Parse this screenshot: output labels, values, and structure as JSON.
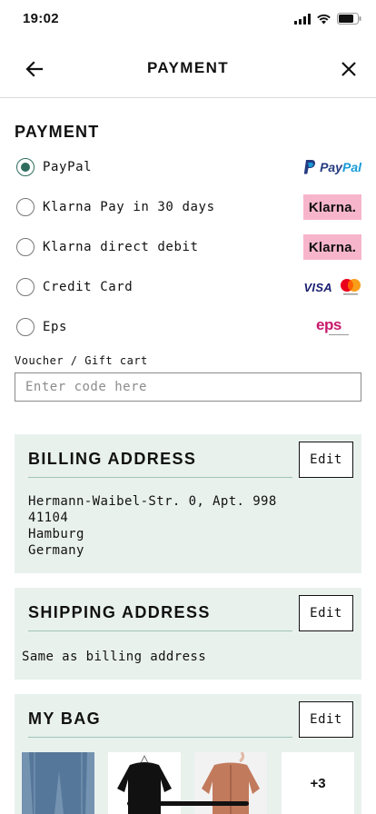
{
  "status_bar": {
    "time": "19:02"
  },
  "nav": {
    "title": "PAYMENT"
  },
  "payment": {
    "title": "PAYMENT",
    "options": [
      {
        "label": "PayPal",
        "selected": true,
        "logo": "paypal-logo"
      },
      {
        "label": "Klarna Pay in 30 days",
        "selected": false,
        "logo": "klarna-logo"
      },
      {
        "label": "Klarna direct debit",
        "selected": false,
        "logo": "klarna-logo"
      },
      {
        "label": "Credit Card",
        "selected": false,
        "logo": "visa-mastercard-logo"
      },
      {
        "label": "Eps",
        "selected": false,
        "logo": "eps-logo"
      }
    ],
    "logos": {
      "paypal": "PayPal",
      "klarna": "Klarna.",
      "visa": "VISA",
      "eps": "eps"
    }
  },
  "voucher": {
    "label": "Voucher / Gift cart",
    "placeholder": "Enter code here"
  },
  "billing": {
    "title": "BILLING ADDRESS",
    "edit_label": "Edit",
    "lines": [
      "Hermann-Waibel-Str. 0, Apt. 998",
      "41104",
      "Hamburg",
      "Germany"
    ]
  },
  "shipping": {
    "title": "SHIPPING ADDRESS",
    "edit_label": "Edit",
    "text": "Same as billing address"
  },
  "bag": {
    "title": "MY BAG",
    "edit_label": "Edit",
    "items": [
      {
        "name": "jeans",
        "color": "#5f7f9e"
      },
      {
        "name": "black-sweater",
        "color": "#111111"
      },
      {
        "name": "rust-jacket",
        "color": "#c27a5c"
      }
    ],
    "more_label": "+3"
  },
  "colors": {
    "accent": "#2f6d5e",
    "card_bg": "#e9f1ed",
    "klarna_pink": "#f7b5cc"
  }
}
